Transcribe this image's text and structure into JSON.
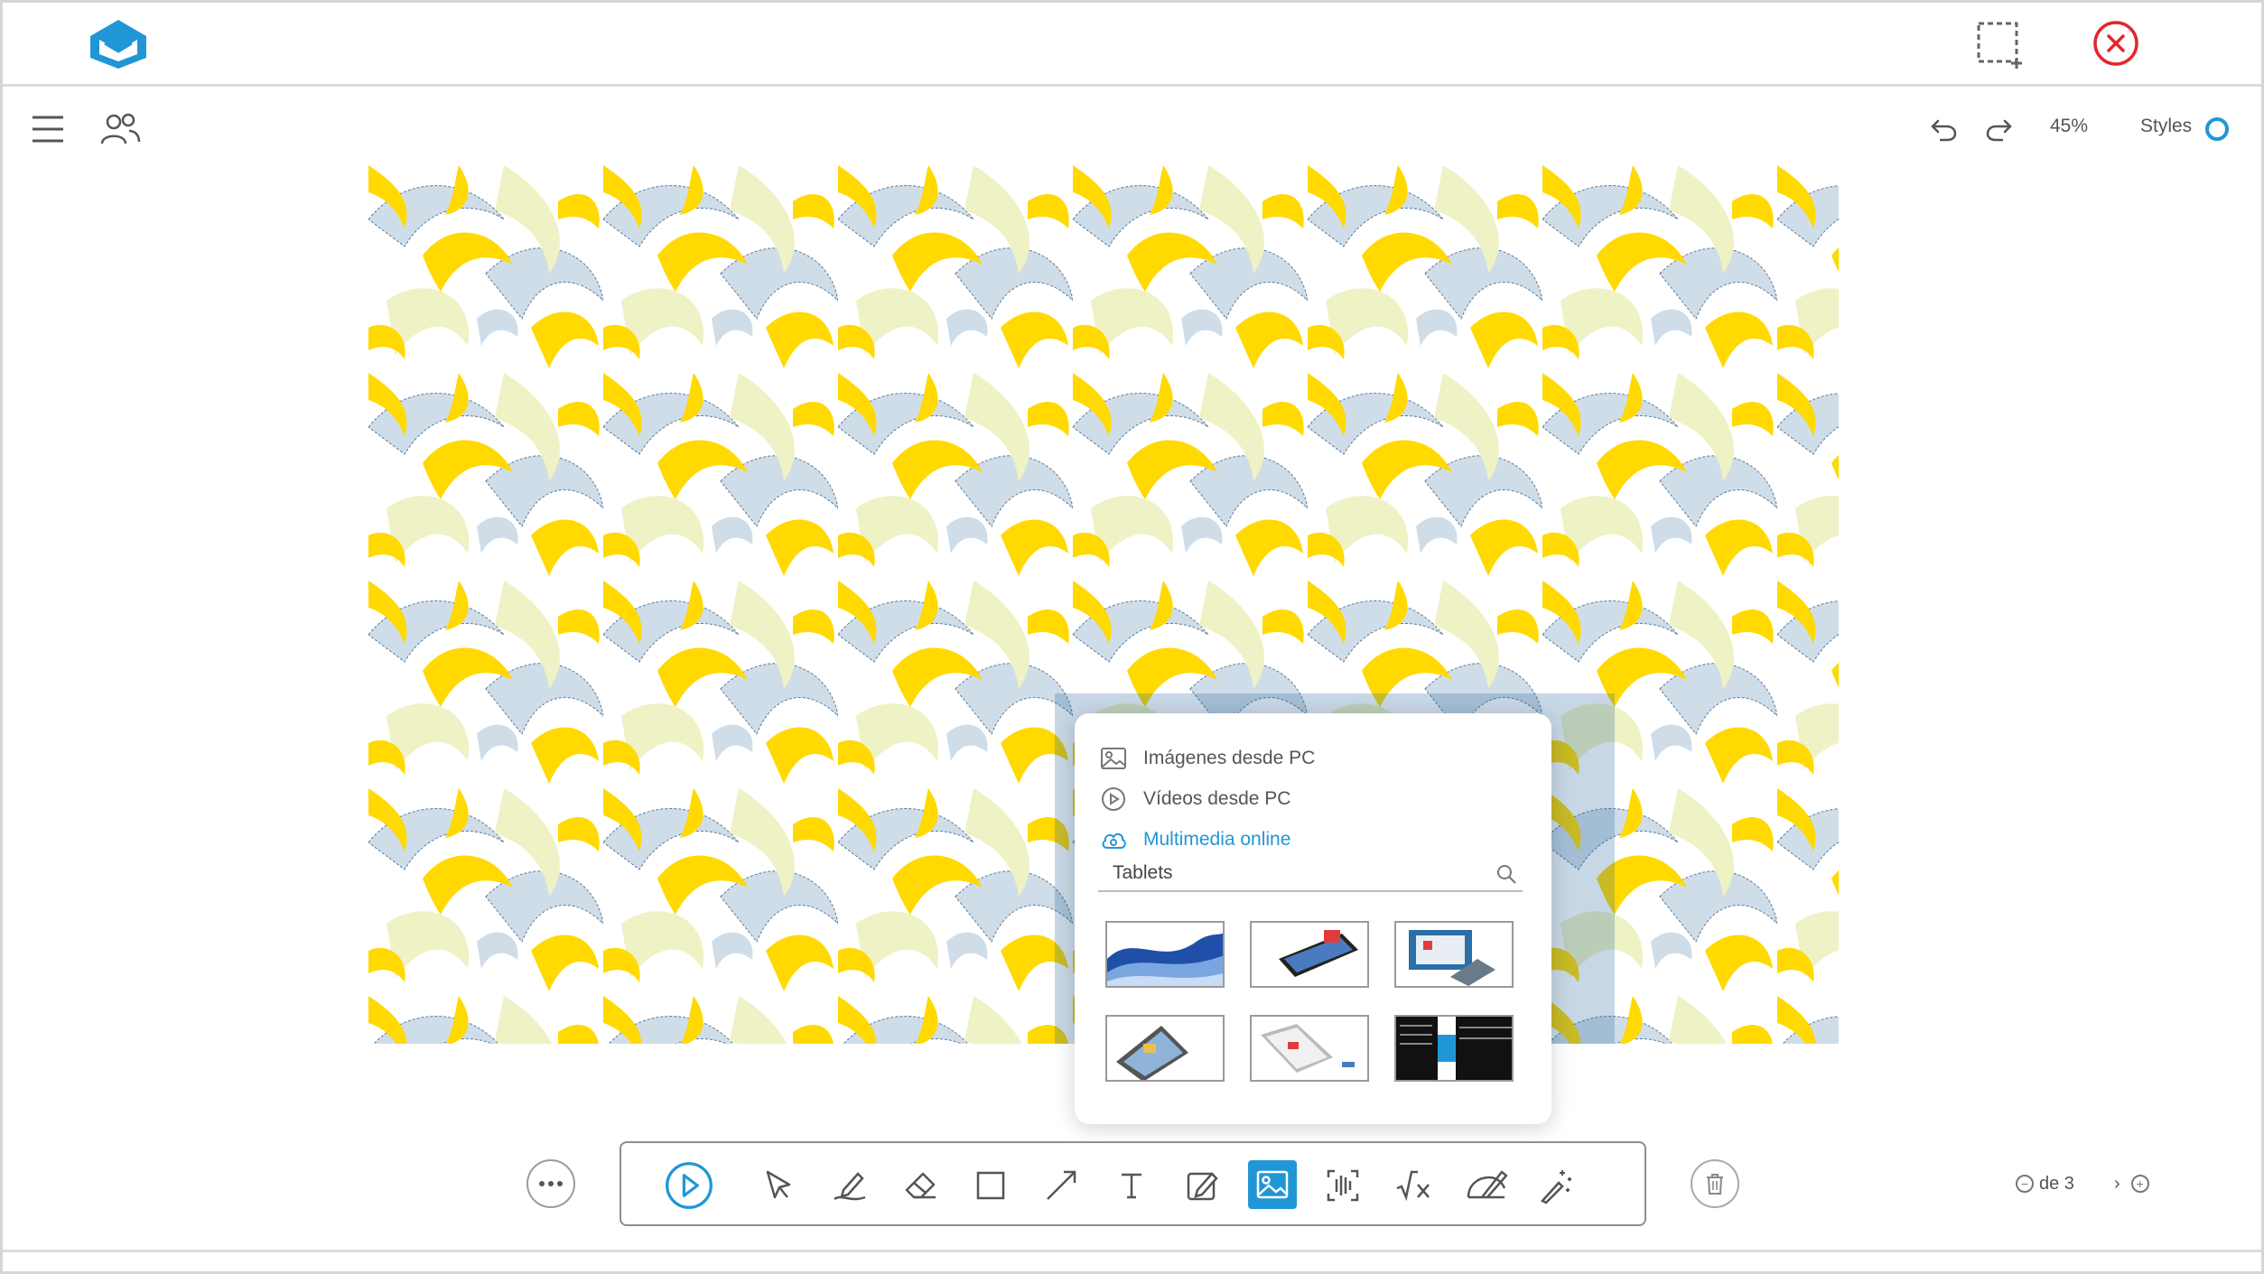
{
  "topbar": {
    "logo_icon": "house-logo-icon",
    "crop_icon": "selection-crop-icon",
    "close_icon": "close-circle-icon"
  },
  "secondary_bar": {
    "menu_icon": "hamburger-menu-icon",
    "users_icon": "users-icon",
    "zoom_label": "45%",
    "styles_label": "Styles"
  },
  "media_popup": {
    "items": [
      {
        "label": "Imágenes desde PC",
        "icon": "image-icon",
        "active": false
      },
      {
        "label": "Vídeos desde PC",
        "icon": "play-circle-icon",
        "active": false
      },
      {
        "label": "Multimedia online",
        "icon": "cloud-icon",
        "active": true
      }
    ],
    "search_value": "Tablets",
    "results_count": 6
  },
  "toolbar": {
    "tools": [
      "play",
      "select",
      "pen",
      "eraser",
      "rectangle",
      "line",
      "text",
      "edit",
      "media",
      "audio",
      "math",
      "geometry",
      "magic"
    ],
    "active_tool": "media"
  },
  "pager": {
    "of_label": "de 3"
  },
  "colors": {
    "accent": "#2196d6",
    "close": "#e3262b",
    "pattern_yellow": "#ffd900",
    "pattern_blue": "#cfdde9",
    "pattern_pale": "#eef2c4"
  }
}
